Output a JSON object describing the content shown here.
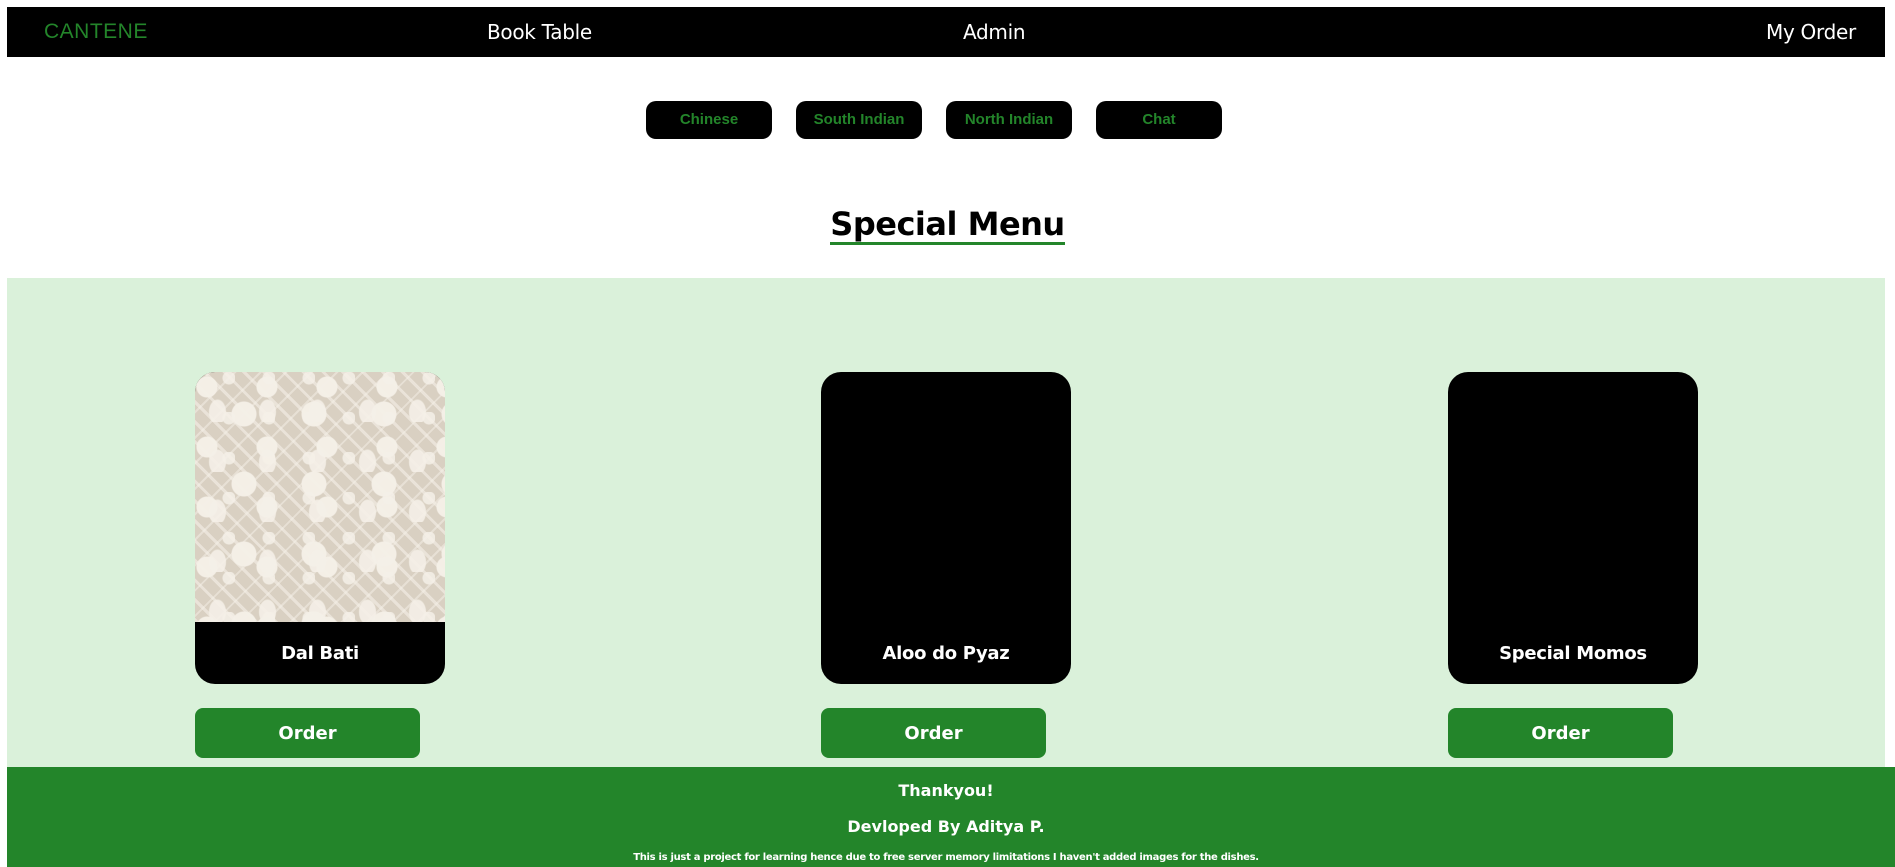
{
  "navbar": {
    "brand": "CANTENE",
    "links": [
      "Book Table",
      "Admin",
      "My Order"
    ]
  },
  "categories": [
    "Chinese",
    "South Indian",
    "North Indian",
    "Chat"
  ],
  "special_menu": {
    "title": "Special Menu",
    "dishes": [
      {
        "name": "Dal Bati",
        "has_image": true,
        "order_label": "Order"
      },
      {
        "name": "Aloo do Pyaz",
        "has_image": false,
        "order_label": "Order"
      },
      {
        "name": "Special Momos",
        "has_image": false,
        "order_label": "Order"
      }
    ]
  },
  "footer": {
    "thanks": "Thankyou!",
    "developer": "Devloped By Aditya P.",
    "note": "This is just a project for learning hence due to free server memory limitations I haven't added images for the dishes."
  },
  "colors": {
    "accent": "#23852a",
    "navbar_bg": "#000000",
    "menu_bg": "#daf1da",
    "footer_bg": "#23852a"
  }
}
